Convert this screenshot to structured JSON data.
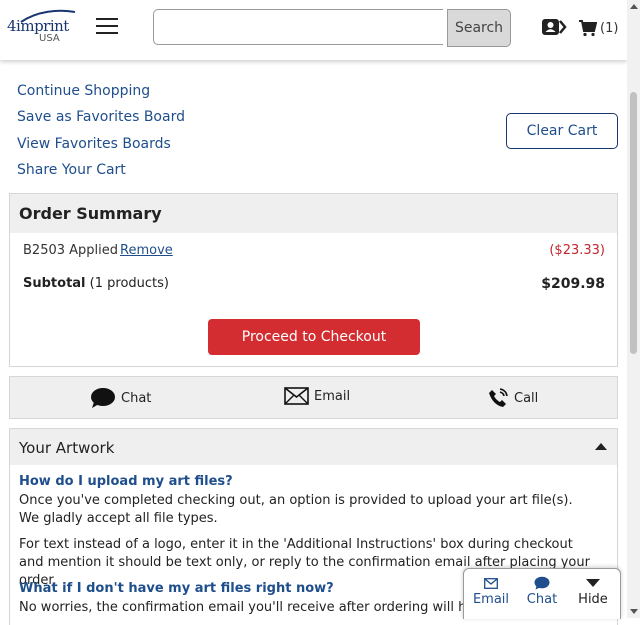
{
  "header": {
    "logo_text": "4imprint",
    "logo_region": "USA",
    "search_placeholder": "",
    "search_button": "Search",
    "cart_count": "(1)"
  },
  "cart_links": {
    "continue_shopping": "Continue Shopping",
    "save_favorites": "Save as Favorites Board",
    "view_favorites": "View Favorites Boards",
    "share_cart": "Share Your Cart",
    "clear_cart": "Clear Cart"
  },
  "order_summary": {
    "title": "Order Summary",
    "promo_text": "B2503 Applied",
    "remove_label": "Remove",
    "discount": "($23.33)",
    "subtotal_label": "Subtotal",
    "subtotal_count": "(1 products)",
    "subtotal_value": "$209.98",
    "checkout_label": "Proceed to Checkout"
  },
  "contact": {
    "chat": "Chat",
    "email": "Email",
    "call": "Call"
  },
  "artwork": {
    "title": "Your Artwork",
    "q1": "How do I upload my art files?",
    "a1": "Once you've completed checking out, an option is provided to upload your art file(s). We gladly accept all file types.",
    "a1b": "For text instead of a logo, enter it in the 'Additional Instructions' box during checkout and mention it should be text only, or reply to the confirmation email after placing your order.",
    "q2": "What if I don't have my art files right now?",
    "a2": "No worries, the confirmation email you'll receive after ordering will have"
  },
  "floating_bar": {
    "email": "Email",
    "chat": "Chat",
    "hide": "Hide"
  },
  "colors": {
    "link": "#1f4e8c",
    "checkout": "#d42d31",
    "discount": "#c0272d",
    "panel": "#efefef"
  }
}
